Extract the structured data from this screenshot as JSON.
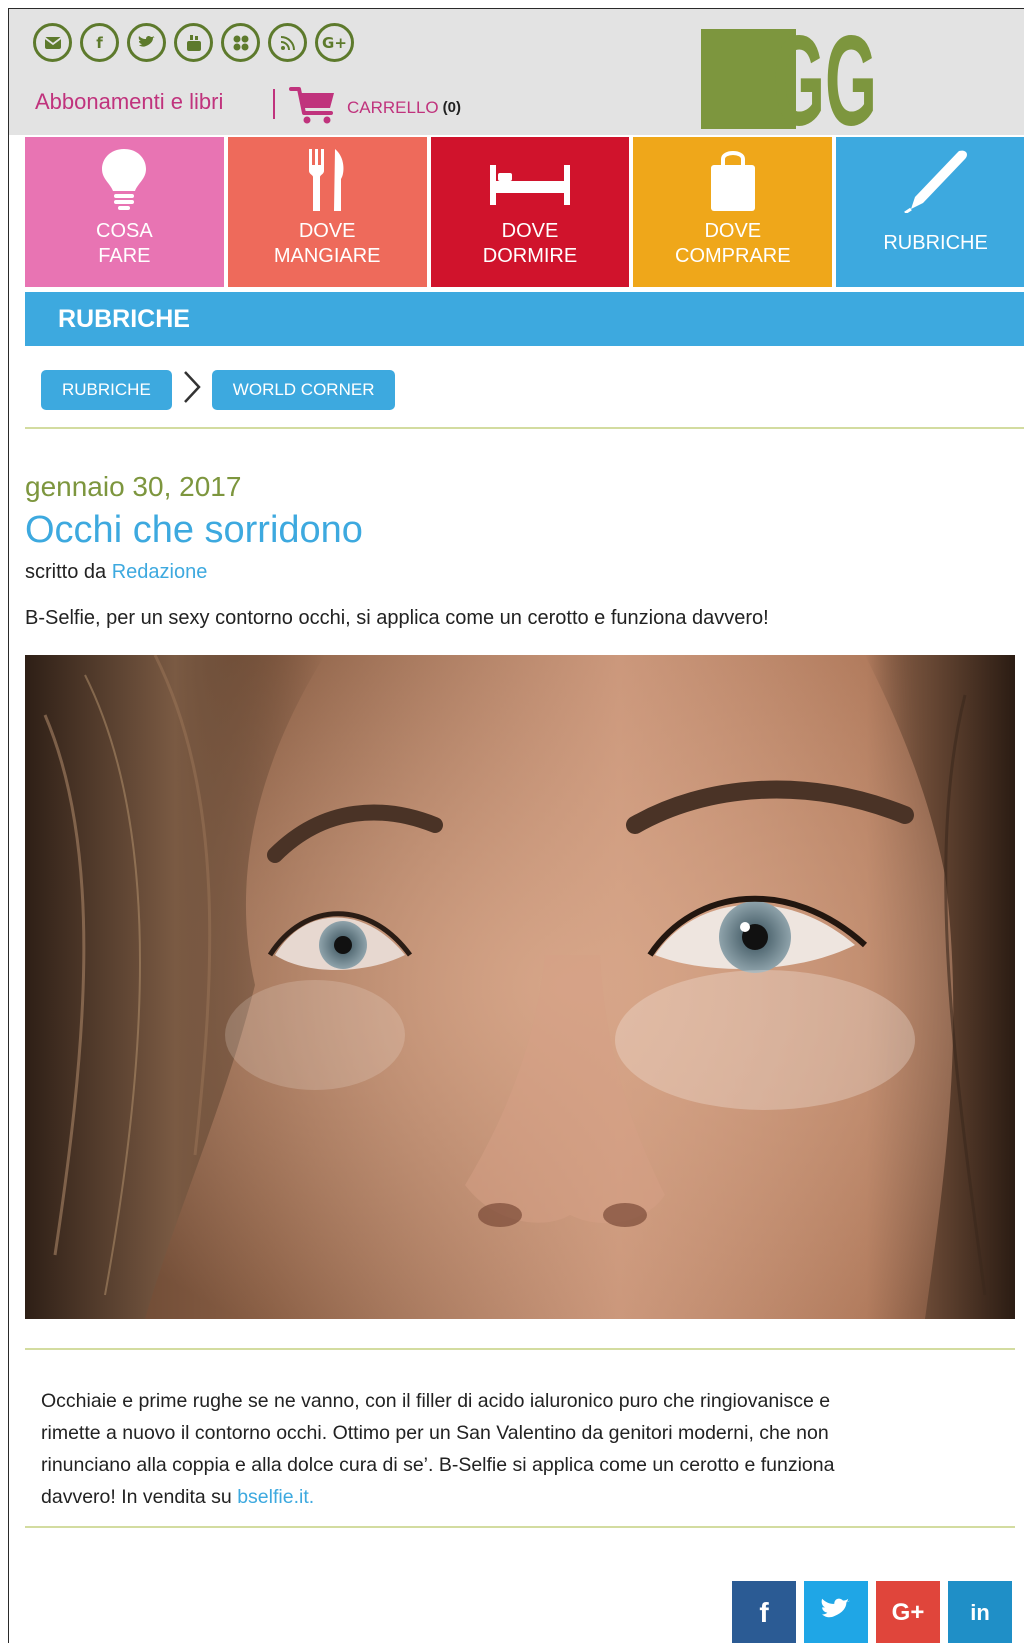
{
  "header": {
    "social_icons": [
      "email-icon",
      "facebook-icon",
      "twitter-icon",
      "youtube-icon",
      "flickr-icon",
      "rss-icon",
      "google-plus-icon"
    ],
    "subscriptions_link": "Abbonamenti e libri",
    "cart_label": "CARRELLO",
    "cart_count": "(0)",
    "logo_text": "GG",
    "colors": {
      "logo_green": "#7d963e",
      "accent_magenta": "#c0337d"
    }
  },
  "categories": [
    {
      "icon": "lightbulb-icon",
      "line1": "COSA",
      "line2": "FARE",
      "color": "#e874b3"
    },
    {
      "icon": "fork-knife-icon",
      "line1": "DOVE",
      "line2": "MANGIARE",
      "color": "#ee6a5b"
    },
    {
      "icon": "bed-icon",
      "line1": "DOVE",
      "line2": "DORMIRE",
      "color": "#d0132c"
    },
    {
      "icon": "shopping-bag-icon",
      "line1": "DOVE",
      "line2": "COMPRARE",
      "color": "#efa71a"
    },
    {
      "icon": "pen-icon",
      "line1": "RUBRICHE",
      "line2": "",
      "color": "#3da9df"
    }
  ],
  "section_title": "RUBRICHE",
  "breadcrumb": [
    "RUBRICHE",
    "WORLD CORNER"
  ],
  "article": {
    "date": "gennaio 30, 2017",
    "title": "Occhi che sorridono",
    "byline_prefix": "scritto da",
    "author": "Redazione",
    "lead": "B-Selfie, per un sexy contorno occhi, si applica come un cerotto e funziona davvero!",
    "body_lines": [
      "Occhiaie e prime rughe se ne vanno, con il filler di acido ialuronico puro che ringiovanisce e",
      "rimette a nuovo il contorno occhi. Ottimo per un San Valentino da genitori moderni, che non",
      "rinunciano alla coppia e alla dolce cura di se’. B-Selfie si applica come un cerotto e funziona"
    ],
    "body_last_prefix": "davvero! In vendita su ",
    "body_link": "bselfie.it.",
    "image_alt": "close-up-woman-eyes-photo"
  },
  "share": [
    {
      "icon": "facebook-share-icon",
      "glyph": "f",
      "color": "#2b5b94"
    },
    {
      "icon": "twitter-share-icon",
      "glyph": "",
      "color": "#1fa6e6"
    },
    {
      "icon": "google-plus-share-icon",
      "glyph": "G+",
      "color": "#e0453b"
    },
    {
      "icon": "linkedin-share-icon",
      "glyph": "in",
      "color": "#1f8fc7"
    }
  ]
}
